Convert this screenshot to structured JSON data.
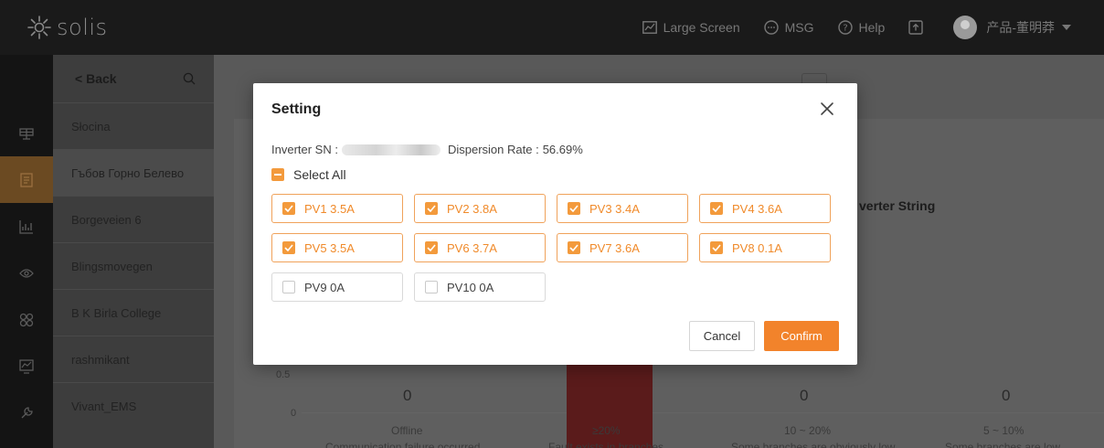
{
  "app": {
    "brand": "solis"
  },
  "topbar": {
    "large_screen": "Large Screen",
    "msg": "MSG",
    "help": "Help",
    "user": "产品-董明莽"
  },
  "rail": {
    "items": [
      {
        "icon": "plant-icon",
        "active": false
      },
      {
        "icon": "document-icon",
        "active": true
      },
      {
        "icon": "chart-icon",
        "active": false
      },
      {
        "icon": "eye-icon",
        "active": false
      },
      {
        "icon": "grid-icon",
        "active": false
      },
      {
        "icon": "monitor-icon",
        "active": false
      },
      {
        "icon": "tools-icon",
        "active": false
      }
    ]
  },
  "plant_list": {
    "back_label": "Back",
    "items": [
      "Słocina",
      "Гъбов Горно Белево",
      "Borgeveien 6",
      "Blingsmovegen",
      "B K Birla College",
      "rashmikant",
      "Vivant_EMS"
    ]
  },
  "background": {
    "chart_title": "verter String",
    "y_ticks": [
      "0.5",
      "0"
    ],
    "values": [
      "0",
      "0",
      "0"
    ],
    "categories": [
      "Offline",
      "≥20%",
      "10 ~ 20%",
      "5 ~ 10%"
    ],
    "captions": [
      "Communication failure occurred",
      "Fault exists in branches",
      "Some branches are obviously low",
      "Some branches are low"
    ]
  },
  "modal": {
    "title": "Setting",
    "sn_label": "Inverter SN :",
    "dispersion_label": "Dispersion Rate :",
    "dispersion_value": "56.69%",
    "select_all": "Select All",
    "strings": [
      {
        "label": "PV1 3.5A",
        "checked": true
      },
      {
        "label": "PV2 3.8A",
        "checked": true
      },
      {
        "label": "PV3 3.4A",
        "checked": true
      },
      {
        "label": "PV4 3.6A",
        "checked": true
      },
      {
        "label": "PV5 3.5A",
        "checked": true
      },
      {
        "label": "PV6 3.7A",
        "checked": true
      },
      {
        "label": "PV7 3.6A",
        "checked": true
      },
      {
        "label": "PV8 0.1A",
        "checked": true
      },
      {
        "label": "PV9 0A",
        "checked": false
      },
      {
        "label": "PV10 0A",
        "checked": false
      }
    ],
    "cancel": "Cancel",
    "confirm": "Confirm"
  },
  "colors": {
    "accent": "#f2832b",
    "topbar": "#1a1a1a"
  }
}
